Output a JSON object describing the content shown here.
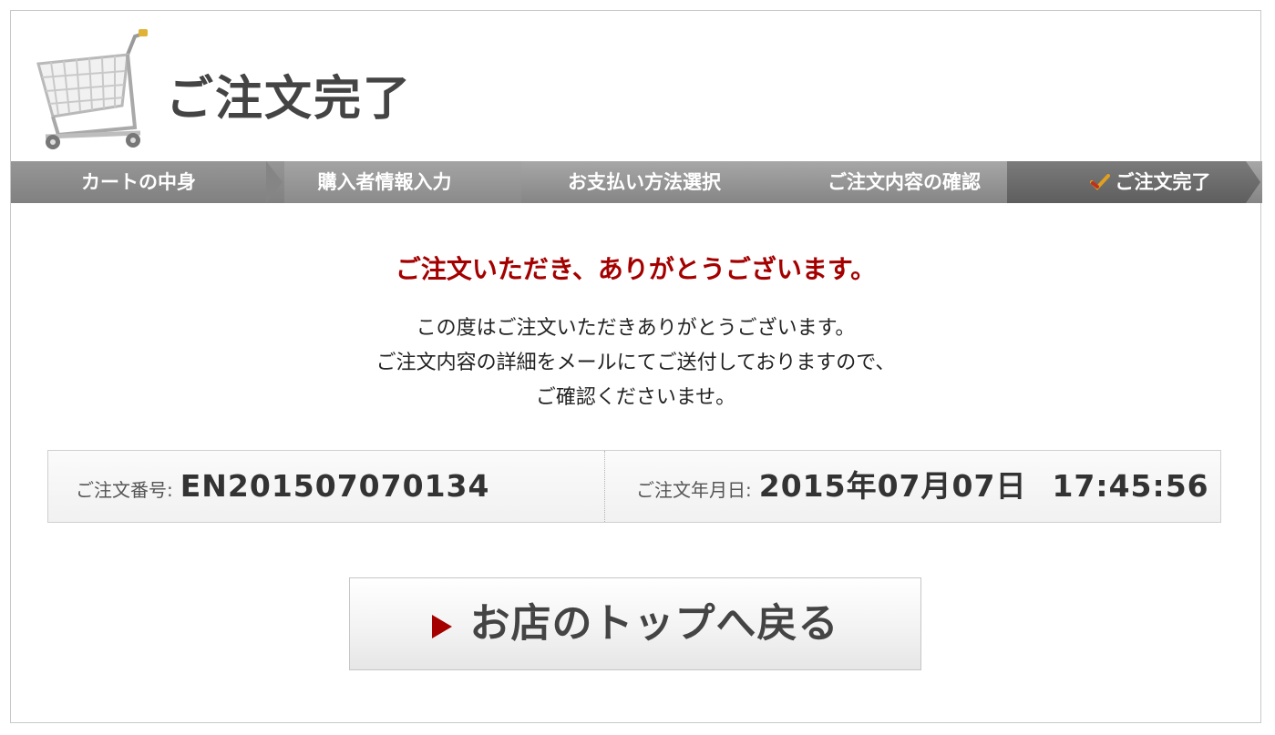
{
  "header": {
    "title": "ご注文完了",
    "cart_icon": "shopping-cart-icon"
  },
  "steps": [
    {
      "label": "カートの中身",
      "active": false
    },
    {
      "label": "購入者情報入力",
      "active": false
    },
    {
      "label": "お支払い方法選択",
      "active": false
    },
    {
      "label": "ご注文内容の確認",
      "active": false
    },
    {
      "label": "ご注文完了",
      "active": true,
      "icon": "check-icon"
    }
  ],
  "thanks": "ご注文いただき、ありがとうございます。",
  "message": {
    "line1": "この度はご注文いただきありがとうございます。",
    "line2": "ご注文内容の詳細をメールにてご送付しておりますので、",
    "line3": "ご確認くださいませ。"
  },
  "order": {
    "number_label": "ご注文番号:",
    "number_value": "EN201507070134",
    "date_label": "ご注文年月日:",
    "date_value": "2015年07月07日",
    "time_value": "17:45:56"
  },
  "button": {
    "label": "お店のトップへ戻る",
    "icon": "play-icon"
  },
  "colors": {
    "accent": "#a40000",
    "step_bar_dark": "#6f6f6f",
    "step_bar_light": "#9a9a9a",
    "text": "#333333"
  }
}
